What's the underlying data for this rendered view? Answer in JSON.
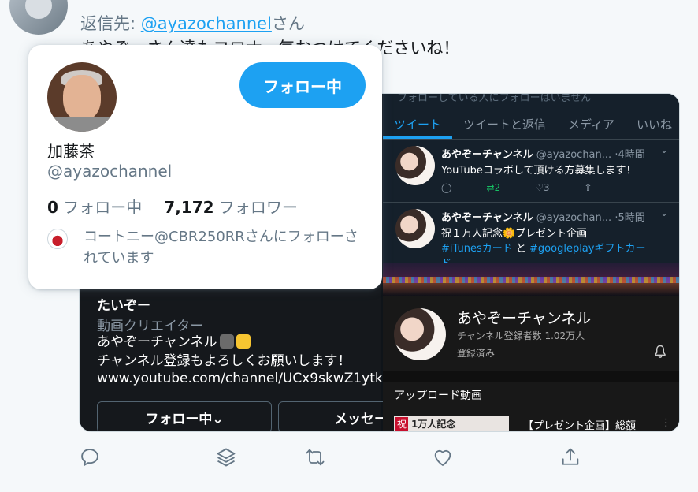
{
  "tweet": {
    "reply_prefix": "返信先:",
    "reply_mention": "@ayazochannel",
    "reply_suffix": "さん",
    "text": "あやぞーさん達もコロナ、気おつけてくださいね！"
  },
  "hover_card": {
    "name": "加藤茶",
    "handle": "@ayazochannel",
    "follow_button": "フォロー中",
    "following_count": "0",
    "following_label": "フォロー中",
    "followers_count": "7,172",
    "followers_label": "フォロワー",
    "mutual_text": "コートニー@CBR250RRさんにフォローされています"
  },
  "media_left": {
    "name": "たいぞー",
    "role": "動画クリエイター",
    "bio_line1": "あやぞーチャンネル",
    "bio_line2": "チャンネル登録もよろしくお願いします！",
    "url": "www.youtube.com/channel/UCx9skwZ1ytk",
    "follow_button": "フォロー中⌄",
    "message_button": "メッセー"
  },
  "media_right_top": {
    "faded_text": "フォローしている人にフォローはいません",
    "tabs": [
      "ツイート",
      "ツイートと返信",
      "メディア",
      "いいね"
    ],
    "tweets": [
      {
        "name": "あやぞーチャンネル",
        "handle": "@ayazochan...",
        "time": "·4時間",
        "text": "YouTubeコラボして頂ける方募集します！",
        "retweets": "2",
        "likes": "3"
      },
      {
        "name": "あやぞーチャンネル",
        "handle": "@ayazochan...",
        "time": "·5時間",
        "text": "祝１万人記念🌼プレゼント企画",
        "tag1": "#iTunesカード",
        "and": "と",
        "tag2": "#googleplayギフトカー",
        "cut": "ド"
      }
    ]
  },
  "media_right_bottom": {
    "channel_name": "あやぞーチャンネル",
    "subscribers": "チャンネル登録者数 1.02万人",
    "subscribed": "登録済み",
    "uploads_label": "アップロード動画",
    "thumb_badge": "祝",
    "thumb_text": "1万人記念",
    "video_title": "【プレゼント企画】総額"
  },
  "colors": {
    "accent": "#1da1f2",
    "retweet_green": "#17bf63"
  },
  "icons": [
    "reply-icon",
    "layers-icon",
    "retweet-icon",
    "like-icon",
    "share-icon"
  ]
}
